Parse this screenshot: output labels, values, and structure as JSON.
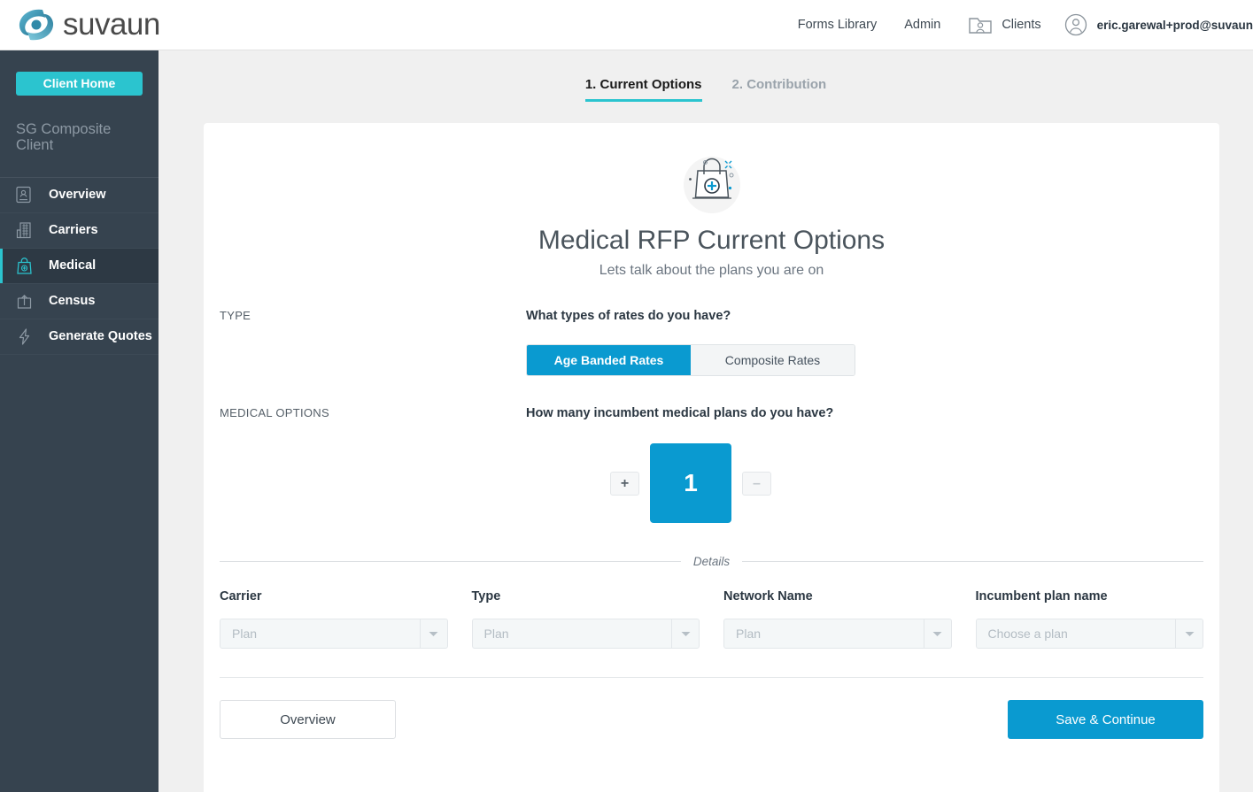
{
  "brand": {
    "name": "suvaun",
    "logo_icon": "suvaun-swirl-logo"
  },
  "topnav": {
    "links": [
      {
        "label": "Forms Library"
      },
      {
        "label": "Admin"
      }
    ],
    "clients": {
      "label": "Clients",
      "icon": "folder-user-icon"
    },
    "user": {
      "email": "eric.garewal+prod@suvaun",
      "icon": "user-avatar-icon"
    }
  },
  "sidebar": {
    "client_home_label": "Client Home",
    "client_name": "SG Composite Client",
    "items": [
      {
        "label": "Overview",
        "icon": "id-card-icon",
        "active": false
      },
      {
        "label": "Carriers",
        "icon": "building-icon",
        "active": false
      },
      {
        "label": "Medical",
        "icon": "medical-bag-icon",
        "active": true
      },
      {
        "label": "Census",
        "icon": "upload-box-icon",
        "active": false
      },
      {
        "label": "Generate Quotes",
        "icon": "lightning-bolt-icon",
        "active": false
      }
    ]
  },
  "tabs": [
    {
      "number": "1.",
      "label": "Current Options",
      "active": true
    },
    {
      "number": "2.",
      "label": "Contribution",
      "active": false
    }
  ],
  "hero": {
    "icon": "medical-bag-plus-icon",
    "title": "Medical RFP Current Options",
    "subtitle": "Lets talk about the plans you are on"
  },
  "type_section": {
    "label": "TYPE",
    "question": "What types of rates do you have?",
    "options": [
      {
        "label": "Age Banded Rates",
        "selected": true
      },
      {
        "label": "Composite Rates",
        "selected": false
      }
    ]
  },
  "medical_options_section": {
    "label": "MEDICAL OPTIONS",
    "question": "How many incumbent medical plans do you have?",
    "increment_label": "+",
    "decrement_label": "–",
    "count": "1"
  },
  "details": {
    "divider_label": "Details",
    "fields": [
      {
        "label": "Carrier",
        "placeholder": "Plan",
        "value": ""
      },
      {
        "label": "Type",
        "placeholder": "Plan",
        "value": ""
      },
      {
        "label": "Network Name",
        "placeholder": "Plan",
        "value": ""
      },
      {
        "label": "Incumbent plan name",
        "placeholder": "Choose a plan",
        "value": ""
      }
    ]
  },
  "actions": {
    "back_label": "Overview",
    "submit_label": "Save & Continue"
  },
  "colors": {
    "accent_blue": "#0a9ad0",
    "accent_teal": "#2bc4cf",
    "sidebar_bg": "#36434f",
    "page_bg": "#f0f0f0"
  }
}
